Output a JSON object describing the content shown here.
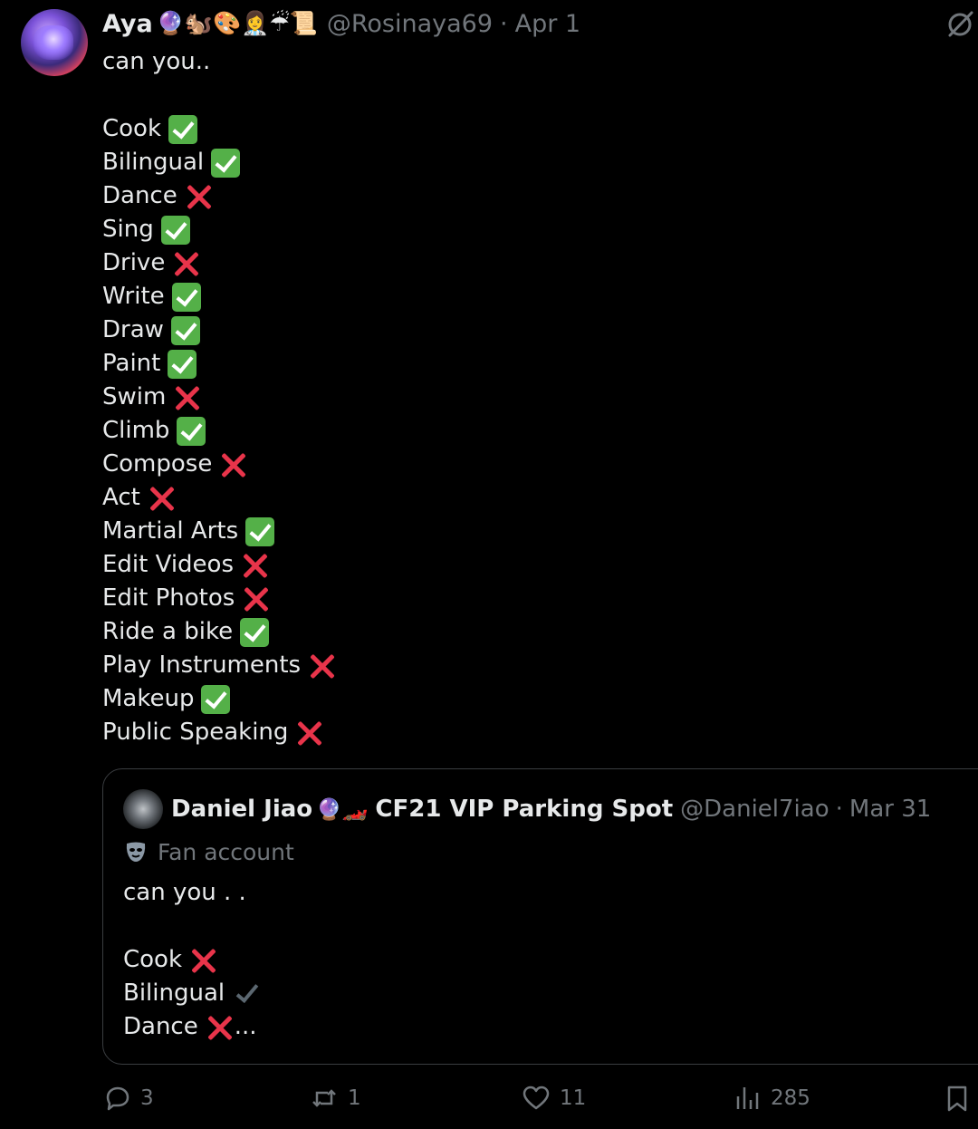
{
  "tweet": {
    "display_name": "Aya",
    "name_emojis": "🔮🐿️🎨👩‍⚕️☔📜",
    "handle": "@Rosinaya69",
    "separator": "·",
    "date": "Apr 1",
    "intro": "can you..",
    "items": [
      {
        "label": "Cook",
        "mark": "check"
      },
      {
        "label": "Bilingual",
        "mark": "check"
      },
      {
        "label": "Dance",
        "mark": "cross"
      },
      {
        "label": "Sing",
        "mark": "check"
      },
      {
        "label": "Drive",
        "mark": "cross"
      },
      {
        "label": "Write",
        "mark": "check"
      },
      {
        "label": "Draw",
        "mark": "check"
      },
      {
        "label": "Paint",
        "mark": "check"
      },
      {
        "label": "Swim",
        "mark": "cross"
      },
      {
        "label": "Climb",
        "mark": "check"
      },
      {
        "label": "Compose",
        "mark": "cross"
      },
      {
        "label": "Act",
        "mark": "cross"
      },
      {
        "label": "Martial Arts",
        "mark": "check"
      },
      {
        "label": "Edit Videos",
        "mark": "cross"
      },
      {
        "label": "Edit Photos",
        "mark": "cross"
      },
      {
        "label": "Ride a bike",
        "mark": "check"
      },
      {
        "label": "Play Instruments",
        "mark": "cross"
      },
      {
        "label": "Makeup",
        "mark": "check"
      },
      {
        "label": "Public Speaking",
        "mark": "cross"
      }
    ]
  },
  "quote": {
    "display_name": "Daniel Jiao",
    "name_emojis": "🔮🏎️",
    "title": "CF21 VIP Parking Spot",
    "handle": "@Daniel7iao",
    "separator": "·",
    "date": "Mar 31",
    "label": "Fan account",
    "intro": "can you . .",
    "items": [
      {
        "label": "Cook",
        "mark": "cross",
        "suffix": ""
      },
      {
        "label": "Bilingual",
        "mark": "heavy",
        "suffix": ""
      },
      {
        "label": "Dance",
        "mark": "cross",
        "suffix": "..."
      }
    ]
  },
  "actions": {
    "replies": "3",
    "reposts": "1",
    "likes": "11",
    "views": "285"
  },
  "icons": {
    "grok": "slashed-circle-icon",
    "reply": "speech-bubble-icon",
    "repost": "repost-arrows-icon",
    "like": "heart-icon",
    "views": "bar-chart-icon",
    "bookmark": "bookmark-icon",
    "label": "mask-icon"
  },
  "colors": {
    "background": "#000000",
    "text": "#e7e9ea",
    "secondary": "#71767b",
    "check": "#54b048",
    "cross": "#e8344a",
    "border": "#3a3d40"
  }
}
